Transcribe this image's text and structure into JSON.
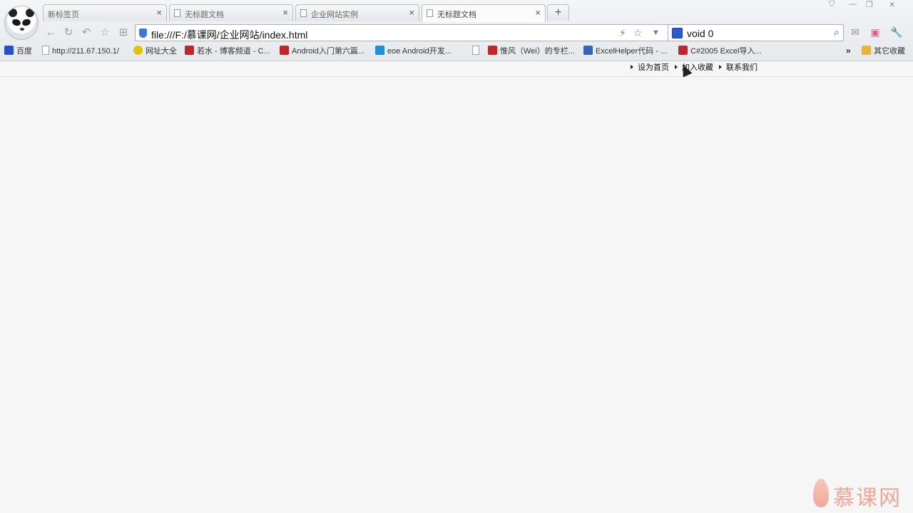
{
  "tabs": [
    {
      "title": "新标签页",
      "close": "×",
      "icon": false
    },
    {
      "title": "无标题文档",
      "close": "×",
      "icon": true
    },
    {
      "title": "企业网站实例",
      "close": "×",
      "icon": true
    },
    {
      "title": "无标题文档",
      "close": "×",
      "icon": true,
      "active": true
    }
  ],
  "new_tab_label": "+",
  "address": {
    "url": "file:///F:/慕课网/企业网站/index.html"
  },
  "search": {
    "value": "void 0"
  },
  "bookmarks": [
    {
      "label": "百度",
      "icon": "baidu-icon"
    },
    {
      "label": "http://211.67.150.1/",
      "icon": "page-icon"
    },
    {
      "label": "网址大全",
      "icon": "hao123-icon"
    },
    {
      "label": "若水 - 博客频道 - C...",
      "icon": "csdn-icon"
    },
    {
      "label": "Android入门第六篇...",
      "icon": "csdn-icon"
    },
    {
      "label": "eoe Android开发...",
      "icon": "eoe-icon"
    },
    {
      "label": "",
      "icon": "page-icon"
    },
    {
      "label": "惟风（Wei）的专栏...",
      "icon": "csdn-icon"
    },
    {
      "label": "ExcelHelper代码 - ...",
      "icon": "excel-icon"
    },
    {
      "label": "C#2005 Excel导入...",
      "icon": "csdn-icon"
    },
    {
      "label": "其它收藏",
      "icon": "folder-icon"
    }
  ],
  "bookmarks_more": "»",
  "page": {
    "top_links": [
      "设为首页",
      "加入收藏",
      "联系我们"
    ]
  },
  "watermark": {
    "text": "慕课网"
  }
}
